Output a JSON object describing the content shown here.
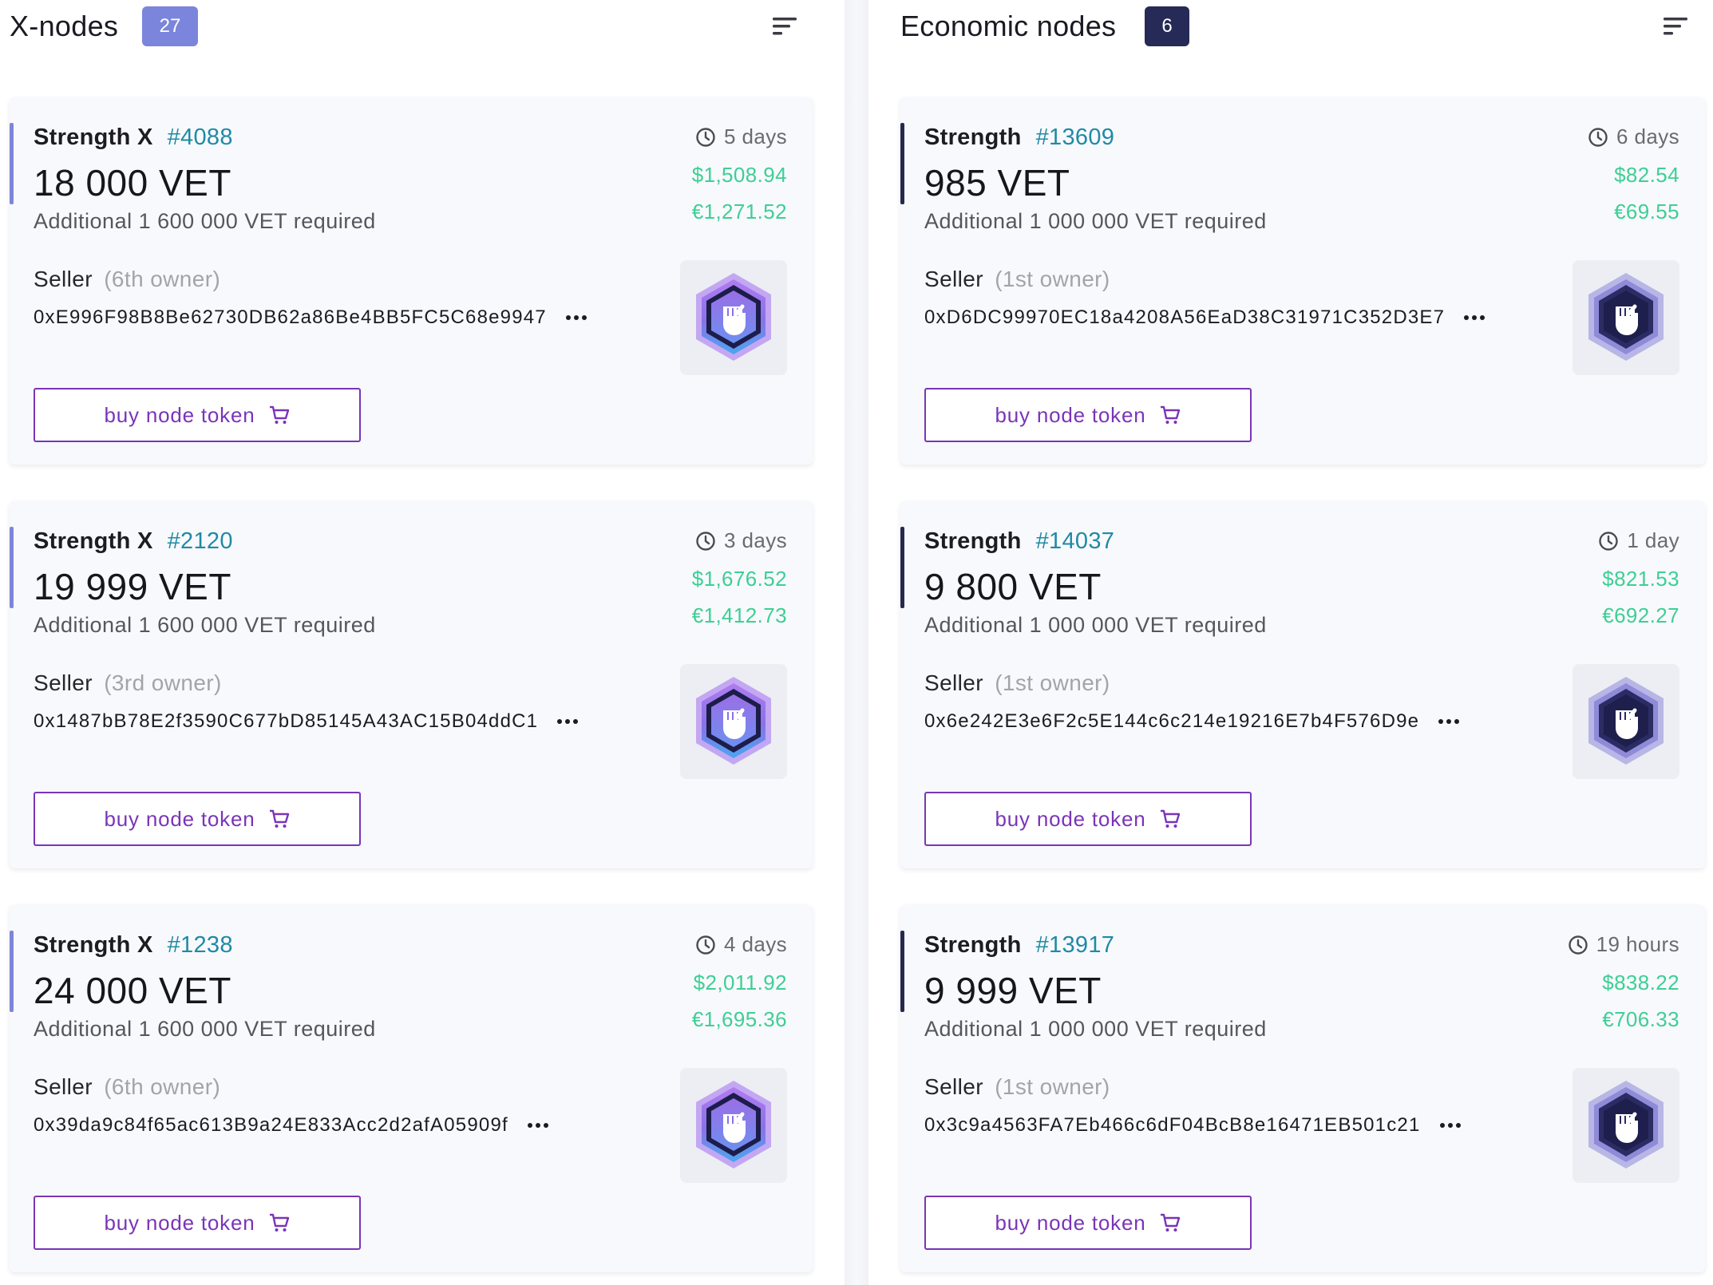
{
  "colors": {
    "accent_purple": "#7a34b8",
    "link_teal": "#1f8aa6",
    "price_green": "#3dcf95",
    "xnodes_badge": "#7b85dc",
    "economic_badge": "#262a56",
    "xnode_accent": "#7d86d8",
    "economic_accent": "#252a4e"
  },
  "xnodes": {
    "title": "X-nodes",
    "count": "27",
    "sort_icon": "sort-icon",
    "cards": [
      {
        "tier": "Strength X",
        "id": "#4088",
        "price": "18 000 VET",
        "additional": "Additional 1 600 000 VET required",
        "time": "5 days",
        "usd": "$1,508.94",
        "eur": "€1,271.52",
        "seller_label": "Seller",
        "owner": "(6th owner)",
        "address": "0xE996F98B8Be62730DB62a86Be4BB5FC5C68e9947",
        "button": "buy node token",
        "badge_icon": "strength-x-badge-icon"
      },
      {
        "tier": "Strength X",
        "id": "#2120",
        "price": "19 999 VET",
        "additional": "Additional 1 600 000 VET required",
        "time": "3 days",
        "usd": "$1,676.52",
        "eur": "€1,412.73",
        "seller_label": "Seller",
        "owner": "(3rd owner)",
        "address": "0x1487bB78E2f3590C677bD85145A43AC15B04ddC1",
        "button": "buy node token",
        "badge_icon": "strength-x-badge-icon"
      },
      {
        "tier": "Strength X",
        "id": "#1238",
        "price": "24 000 VET",
        "additional": "Additional 1 600 000 VET required",
        "time": "4 days",
        "usd": "$2,011.92",
        "eur": "€1,695.36",
        "seller_label": "Seller",
        "owner": "(6th owner)",
        "address": "0x39da9c84f65ac613B9a24E833Acc2d2afA05909f",
        "button": "buy node token",
        "badge_icon": "strength-x-badge-icon"
      }
    ]
  },
  "economic": {
    "title": "Economic nodes",
    "count": "6",
    "sort_icon": "sort-icon",
    "cards": [
      {
        "tier": "Strength",
        "id": "#13609",
        "price": "985 VET",
        "additional": "Additional 1 000 000 VET required",
        "time": "6 days",
        "usd": "$82.54",
        "eur": "€69.55",
        "seller_label": "Seller",
        "owner": "(1st owner)",
        "address": "0xD6DC99970EC18a4208A56EaD38C31971C352D3E7",
        "button": "buy node token",
        "badge_icon": "strength-badge-icon"
      },
      {
        "tier": "Strength",
        "id": "#14037",
        "price": "9 800 VET",
        "additional": "Additional 1 000 000 VET required",
        "time": "1 day",
        "usd": "$821.53",
        "eur": "€692.27",
        "seller_label": "Seller",
        "owner": "(1st owner)",
        "address": "0x6e242E3e6F2c5E144c6c214e19216E7b4F576D9e",
        "button": "buy node token",
        "badge_icon": "strength-badge-icon"
      },
      {
        "tier": "Strength",
        "id": "#13917",
        "price": "9 999 VET",
        "additional": "Additional 1 000 000 VET required",
        "time": "19 hours",
        "usd": "$838.22",
        "eur": "€706.33",
        "seller_label": "Seller",
        "owner": "(1st owner)",
        "address": "0x3c9a4563FA7Eb466c6dF04BcB8e16471EB501c21",
        "button": "buy node token",
        "badge_icon": "strength-badge-icon"
      }
    ]
  }
}
